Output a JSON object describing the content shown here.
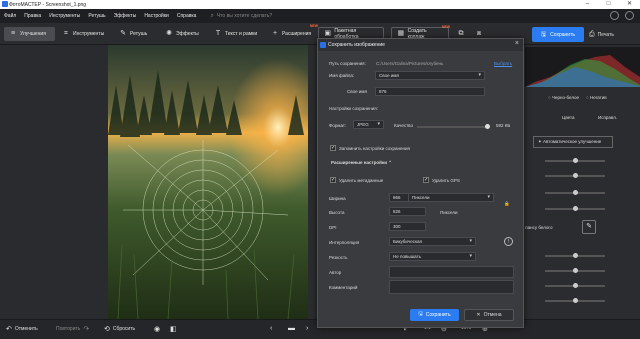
{
  "app": {
    "title": "ФотоМАСТЕР - Screenshot_1.png",
    "menu": [
      "Файл",
      "Правка",
      "Инструменты",
      "Ретушь",
      "Эффекты",
      "Настройки",
      "Справка"
    ],
    "search_placeholder": "Что вы хотите сделать?"
  },
  "toolbar": {
    "tabs": [
      {
        "label": "Улучшения",
        "icon": "enhance-icon"
      },
      {
        "label": "Инструменты",
        "icon": "crop-icon"
      },
      {
        "label": "Ретушь",
        "icon": "brush-icon"
      },
      {
        "label": "Эффекты",
        "icon": "effects-icon"
      },
      {
        "label": "Текст и рамки",
        "icon": "text-icon"
      },
      {
        "label": "Расширения",
        "icon": "plus-icon",
        "badge": "NEW"
      }
    ],
    "batch_label": "Пакетная обработка",
    "collage_label": "Создать коллаж",
    "collage_badge": "NEW",
    "save_label": "Сохранить",
    "print_label": "Печать"
  },
  "bottom": {
    "undo_label": "Отменить",
    "redo_label": "Повторить",
    "reset_label": "Сбросить",
    "zoom_fit": "1:1",
    "zoom_level": "16%"
  },
  "right_panel": {
    "mode_bw": "Черно-белое",
    "mode_negative": "Негатив",
    "tab_colors": "Цвета",
    "tab_fix": "Исправл.",
    "auto_enhance": "Автоматическое улучшение",
    "wb_label": "лансу белого"
  },
  "dialog": {
    "title": "Сохранить изображение",
    "save_path_label": "Путь сохранения:",
    "save_path_value": "C:/Users/Galina/Pictures/клубень",
    "choose_link": "Выбрать",
    "filename_label": "Имя файла:",
    "filename_value": "Свое имя",
    "own_name_label": "Свое имя",
    "own_name_value": "876",
    "settings_header": "Настройки сохранения:",
    "format_label": "Формат:",
    "format_value": "JPEG",
    "quality_label": "Качество",
    "file_size": "592 КБ",
    "remember_label": "Запомнить настройки сохранения",
    "advanced_label": "Расширенные настройки",
    "delete_meta_label": "Удалить метаданные",
    "delete_gps_label": "Удалить GPS",
    "width_label": "Ширина",
    "width_value": "866",
    "height_label": "Высота",
    "height_value": "826",
    "units_value": "Пиксели",
    "units_label": "Пиксели",
    "dpi_label": "DPI",
    "dpi_value": "300",
    "interp_label": "Интерполяция",
    "interp_value": "Бикубическая",
    "sharp_label": "Резкость",
    "sharp_value": "Не повышать",
    "author_label": "Автор",
    "comment_label": "Комментарий",
    "save_button": "Сохранить",
    "cancel_button": "Отмена"
  },
  "colors": {
    "accent": "#2a7cf0",
    "badge": "#ff6a3d"
  }
}
